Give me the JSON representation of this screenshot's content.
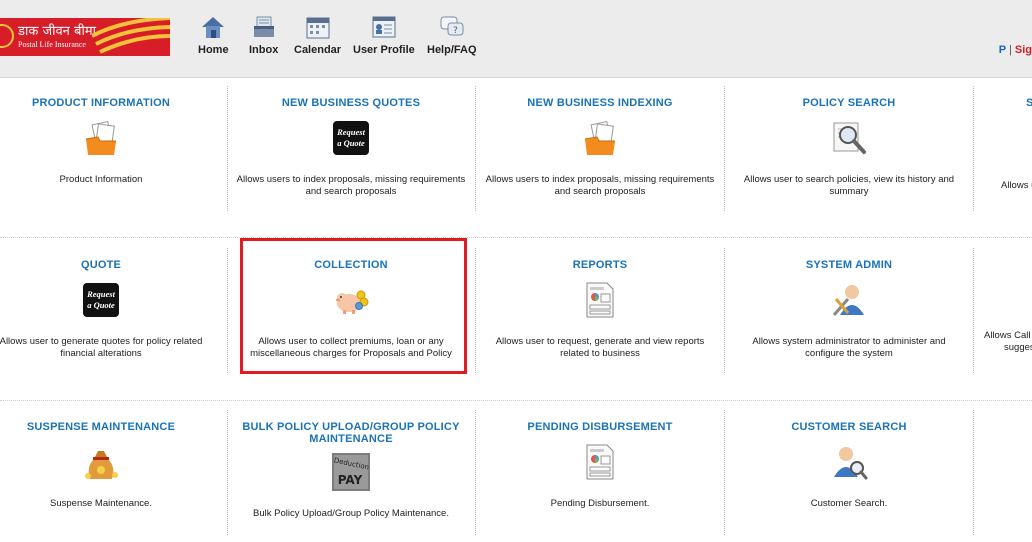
{
  "brand": {
    "hindi_name": "डाक जीवन बीमा",
    "english_name": "Postal Life Insurance",
    "primary_color": "#d71e28",
    "accent_color": "#f5c33b"
  },
  "nav": [
    {
      "label": "Home",
      "icon": "home-icon"
    },
    {
      "label": "Inbox",
      "icon": "inbox-icon"
    },
    {
      "label": "Calendar",
      "icon": "calendar-icon"
    },
    {
      "label": "User Profile",
      "icon": "user-profile-icon"
    },
    {
      "label": "Help/FAQ",
      "icon": "help-faq-icon"
    }
  ],
  "user_links": {
    "first": "P",
    "separator": "|",
    "second": "Sig"
  },
  "tiles": {
    "product_information": {
      "title": "PRODUCT INFORMATION",
      "desc": "Product Information",
      "icon": "documents-folder-icon"
    },
    "new_business_quotes": {
      "title": "NEW BUSINESS QUOTES",
      "desc": "Allows users to index proposals, missing requirements and search proposals",
      "icon": "request-a-quote-icon",
      "icon_text_1": "Request",
      "icon_text_2": "a Quote"
    },
    "new_business_indexing": {
      "title": "NEW BUSINESS INDEXING",
      "desc": "Allows users to index proposals, missing requirements and search proposals",
      "icon": "documents-folder-icon"
    },
    "policy_search": {
      "title": "POLICY SEARCH",
      "desc": "Allows user to search policies, view its history and summary",
      "icon": "magnifier-document-icon"
    },
    "partial_r1": {
      "title": "S",
      "desc": "Allows u",
      "icon": "none"
    },
    "quote": {
      "title": "QUOTE",
      "desc": "Allows user to generate quotes for policy related financial alterations",
      "icon": "request-a-quote-icon",
      "icon_text_1": "Request",
      "icon_text_2": "a Quote"
    },
    "collection": {
      "title": "COLLECTION",
      "desc": "Allows user to collect premiums, loan or any miscellaneous charges for Proposals and Policy",
      "icon": "piggy-bank-coins-icon"
    },
    "reports": {
      "title": "REPORTS",
      "desc": "Allows user to request, generate and view reports related to business",
      "icon": "report-document-icon"
    },
    "system_admin": {
      "title": "SYSTEM ADMIN",
      "desc": "Allows system administrator to administer and configure the system",
      "icon": "admin-tools-user-icon"
    },
    "partial_r2": {
      "title": "",
      "desc_1": "Allows Call c",
      "desc_2": "sugges",
      "icon": "none"
    },
    "suspense_maintenance": {
      "title": "SUSPENSE MAINTENANCE",
      "desc": "Suspense Maintenance.",
      "icon": "money-bag-icon"
    },
    "bulk_policy_upload": {
      "title": "BULK POLICY UPLOAD/GROUP POLICY MAINTENANCE",
      "desc": "Bulk Policy Upload/Group Policy Maintenance.",
      "icon": "deduction-pay-icon",
      "icon_text_1": "Deduction",
      "icon_text_2": "PAY"
    },
    "pending_disbursement": {
      "title": "PENDING DISBURSEMENT",
      "desc": "Pending Disbursement.",
      "icon": "report-document-icon"
    },
    "customer_search": {
      "title": "CUSTOMER SEARCH",
      "desc": "Customer Search.",
      "icon": "user-search-icon"
    }
  },
  "highlight_color": "#e21b23",
  "title_color": "#1a73b8"
}
